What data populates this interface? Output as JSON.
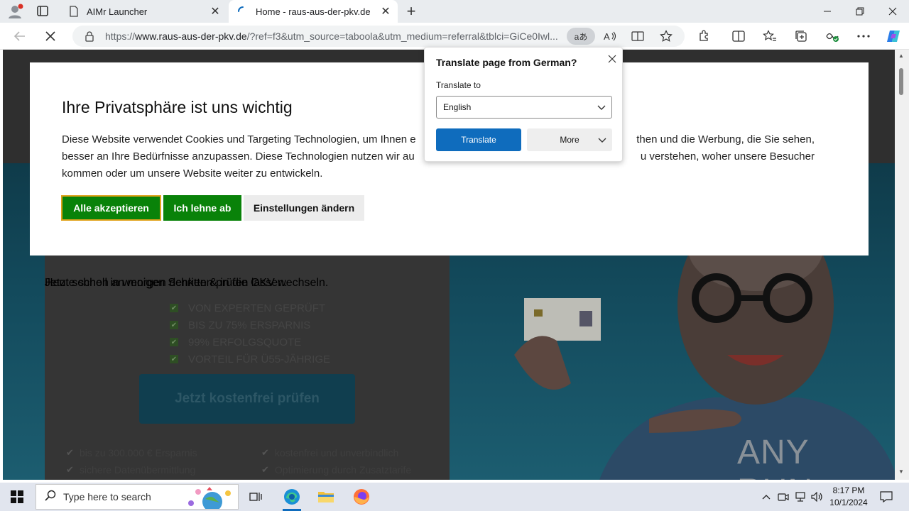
{
  "browser": {
    "tabs": [
      {
        "title": "AIMr Launcher",
        "active": false
      },
      {
        "title": "Home - raus-aus-der-pkv.de",
        "active": true
      }
    ],
    "url_prefix": "https://",
    "url_domain": "www.raus-aus-der-pkv.de",
    "url_rest": "/?ref=f3&utm_source=taboola&utm_medium=referral&tblci=GiCe0Iwl...",
    "translate_pill": "aあ"
  },
  "cookie_banner": {
    "title": "Ihre Privatsphäre ist uns wichtig",
    "line1": "Diese Website verwendet Cookies und Targeting Technologien, um Ihnen e",
    "line1_right": "then und die Werbung, die Sie sehen,",
    "line2": "besser an Ihre Bedürfnisse anzupassen. Diese Technologien nutzen wir au",
    "line2_right": "u verstehen, woher unsere Besucher",
    "line3": "kommen oder um unsere Website weiter zu entwickeln.",
    "accept_label": "Alle akzeptieren",
    "reject_label": "Ich lehne ab",
    "settings_label": "Einstellungen ändern"
  },
  "translate_popup": {
    "title": "Translate page from German?",
    "label": "Translate to",
    "selected_language": "English",
    "translate_label": "Translate",
    "more_label": "More"
  },
  "page": {
    "subline1": "Heute schon an morgen denken & in die GKV wechseln.",
    "subline2": "Jetzt schnell in wenigen Schritten prüfen lassen.",
    "checklist": [
      "VON EXPERTEN GEPRÜFT",
      "BIS ZU 75% ERSPARNIS",
      "99% ERFOLGSQUOTE",
      "VORTEIL FÜR Ü55-JÄHRIGE"
    ],
    "cta_label": "Jetzt kostenfrei prüfen",
    "benefits": [
      "bis zu 300.000 € Ersparnis",
      "kostenfrei und unverbindlich",
      "sichere Datenübermittlung",
      "Optimierung durch Zusatztarife"
    ],
    "watermark": "ANY RUN"
  },
  "taskbar": {
    "search_placeholder": "Type here to search",
    "time": "8:17 PM",
    "date": "10/1/2024"
  },
  "colors": {
    "accept_bg": "#098209",
    "accept_border": "#e0a21a",
    "translate_btn": "#0f6cbd"
  }
}
